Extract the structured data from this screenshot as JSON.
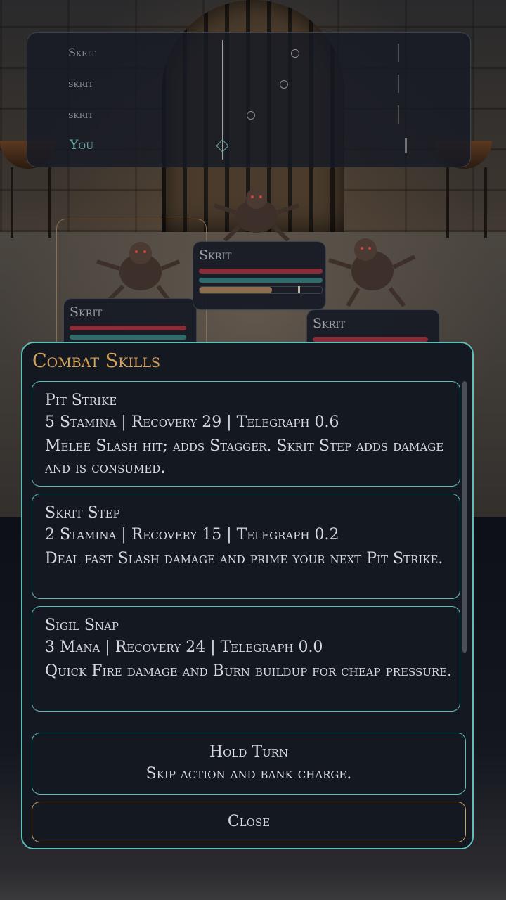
{
  "turn_order": [
    {
      "name": "Skrit"
    },
    {
      "name": "skrit"
    },
    {
      "name": "skrit"
    },
    {
      "name": "You"
    }
  ],
  "enemies": [
    {
      "name": "Skrit"
    },
    {
      "name": "Skrit"
    },
    {
      "name": "Skrit"
    }
  ],
  "modal": {
    "title": "Combat Skills",
    "skills": [
      {
        "name": "Pit Strike",
        "cost": "5 Stamina | Recovery 29 | Telegraph 0.6",
        "desc": "Melee Slash hit; adds Stagger. Skrit Step adds damage and is consumed."
      },
      {
        "name": "Skrit Step",
        "cost": "2 Stamina | Recovery 15 | Telegraph 0.2",
        "desc": "Deal fast Slash damage and prime your next Pit Strike."
      },
      {
        "name": "Sigil Snap",
        "cost": "3 Mana | Recovery 24 | Telegraph 0.0",
        "desc": "Quick Fire damage and Burn buildup for cheap pressure."
      }
    ],
    "hold_title": "Hold Turn",
    "hold_desc": "Skip action and bank charge.",
    "close_label": "Close"
  },
  "colors": {
    "accent": "#5dbfb8",
    "gold": "#d9a35a",
    "hp": "#8a2c37",
    "mana": "#2f6b6a"
  }
}
